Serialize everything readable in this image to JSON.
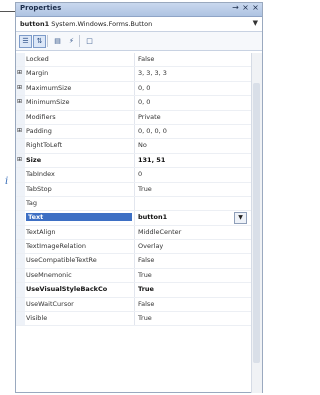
{
  "panel": {
    "title": "Properties",
    "title_buttons": [
      "→",
      "×",
      "×"
    ]
  },
  "object_selector": {
    "name": "button1",
    "type": "System.Windows.Forms.Button"
  },
  "toolbar": {
    "icons": [
      "categorized-icon",
      "alphabetical-icon",
      "properties-icon",
      "events-icon",
      "property-pages-icon"
    ]
  },
  "annotation": "i",
  "properties": [
    {
      "name": "Locked",
      "value": "False",
      "expand": false,
      "bold": false,
      "selected": false
    },
    {
      "name": "Margin",
      "value": "3, 3, 3, 3",
      "expand": true,
      "bold": false,
      "selected": false
    },
    {
      "name": "MaximumSize",
      "value": "0, 0",
      "expand": true,
      "bold": false,
      "selected": false
    },
    {
      "name": "MinimumSize",
      "value": "0, 0",
      "expand": true,
      "bold": false,
      "selected": false
    },
    {
      "name": "Modifiers",
      "value": "Private",
      "expand": false,
      "bold": false,
      "selected": false
    },
    {
      "name": "Padding",
      "value": "0, 0, 0, 0",
      "expand": true,
      "bold": false,
      "selected": false
    },
    {
      "name": "RightToLeft",
      "value": "No",
      "expand": false,
      "bold": false,
      "selected": false
    },
    {
      "name": "Size",
      "value": "131, 51",
      "expand": true,
      "bold": true,
      "selected": false
    },
    {
      "name": "TabIndex",
      "value": "0",
      "expand": false,
      "bold": false,
      "selected": false
    },
    {
      "name": "TabStop",
      "value": "True",
      "expand": false,
      "bold": false,
      "selected": false
    },
    {
      "name": "Tag",
      "value": "",
      "expand": false,
      "bold": false,
      "selected": false
    },
    {
      "name": "Text",
      "value": "button1",
      "expand": false,
      "bold": true,
      "selected": true
    },
    {
      "name": "TextAlign",
      "value": "MiddleCenter",
      "expand": false,
      "bold": false,
      "selected": false
    },
    {
      "name": "TextImageRelation",
      "value": "Overlay",
      "expand": false,
      "bold": false,
      "selected": false
    },
    {
      "name": "UseCompatibleTextRe",
      "value": "False",
      "expand": false,
      "bold": false,
      "selected": false
    },
    {
      "name": "UseMnemonic",
      "value": "True",
      "expand": false,
      "bold": false,
      "selected": false
    },
    {
      "name": "UseVisualStyleBackCo",
      "value": "True",
      "expand": false,
      "bold": true,
      "selected": false
    },
    {
      "name": "UseWaitCursor",
      "value": "False",
      "expand": false,
      "bold": false,
      "selected": false
    },
    {
      "name": "Visible",
      "value": "True",
      "expand": false,
      "bold": false,
      "selected": false
    }
  ]
}
